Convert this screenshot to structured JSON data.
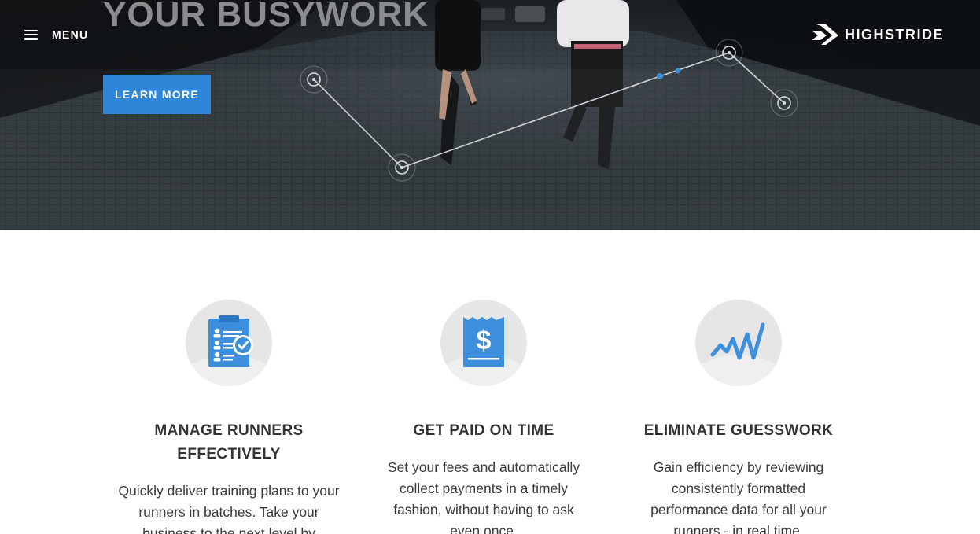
{
  "hero": {
    "headline": "YOUR BUSYWORK",
    "menu_label": "MENU",
    "brand": "HIGHSTRIDE",
    "cta_label": "LEARN MORE"
  },
  "features": [
    {
      "icon": "clipboard-runners-icon",
      "title_line1": "MANAGE RUNNERS",
      "title_line2": "EFFECTIVELY",
      "body": "Quickly deliver training plans to your runners in batches. Take your business to the next level by"
    },
    {
      "icon": "invoice-dollar-icon",
      "title_line1": "GET PAID ON TIME",
      "title_line2": "",
      "body": "Set your fees and automatically collect payments in a timely fashion, without having to ask even once."
    },
    {
      "icon": "performance-graph-icon",
      "title_line1": "ELIMINATE GUESSWORK",
      "title_line2": "",
      "body": "Gain efficiency by reviewing consistently formatted performance data for all your runners - in real time."
    }
  ],
  "colors": {
    "accent": "#2e86d8",
    "icon_blue": "#3d8fdc",
    "icon_bg": "#e6e6e6",
    "heading": "#333333",
    "body_text": "#3a3a3a"
  }
}
